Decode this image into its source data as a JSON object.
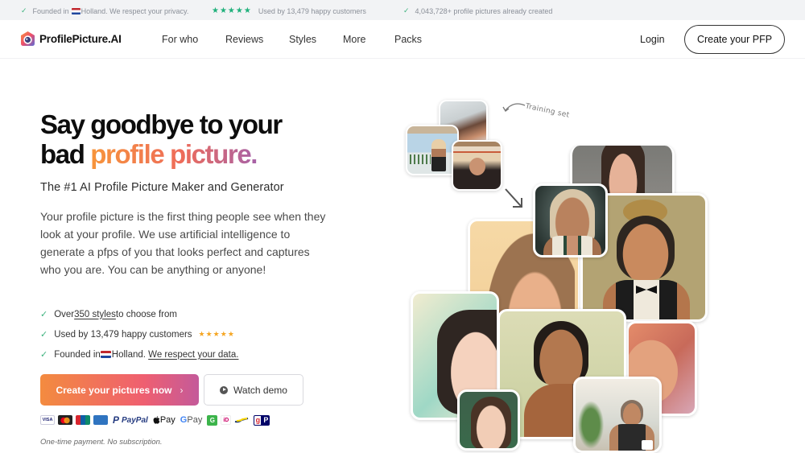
{
  "topbar": {
    "items": [
      {
        "icon": "check-icon",
        "text_prefix": "Founded in ",
        "flag": "netherlands-flag",
        "text_suffix": "Holland. We respect your privacy."
      },
      {
        "icon": "stars-icon",
        "stars": "★★★★★",
        "text": "Used by 13,479 happy customers"
      },
      {
        "icon": "check-icon",
        "text": "4,043,728+ profile pictures already created"
      }
    ],
    "check_glyph": "✓"
  },
  "nav": {
    "brand": "ProfilePicture.AI",
    "links": [
      "For who",
      "Reviews",
      "Styles",
      "More",
      "Packs"
    ],
    "login": "Login",
    "cta": "Create your PFP"
  },
  "hero": {
    "headline_line1": "Say goodbye to your",
    "headline_line2_plain": "bad ",
    "headline_line2_gradient": "profile picture.",
    "subtitle": "The #1 AI Profile Picture Maker and Generator",
    "description": "Your profile picture is the first thing people see when they look at your profile. We use artificial intelligence to generate a pfps of you that looks perfect and captures who you are. You can be anything or anyone!",
    "features": [
      {
        "pre": "Over ",
        "link": "350 styles ",
        "post": "to choose from"
      },
      {
        "pre": "Used by 13,479 happy customers",
        "stars": "★★★★★"
      },
      {
        "pre": "Founded in ",
        "flag": "netherlands-flag",
        "mid": "Holland. ",
        "link": "We respect your data."
      }
    ],
    "primary_button": "Create your pictures now",
    "primary_chevron": "›",
    "demo_button": "Watch demo",
    "payment_methods": [
      "VISA",
      "Mastercard",
      "UnionPay",
      "Amex",
      "PayPal",
      "Apple Pay",
      "Google Pay",
      "G",
      "iDEAL",
      "Bancontact",
      "giropay"
    ],
    "payment_labels": {
      "visa": "VISA",
      "paypal": "PayPal",
      "applepay": " Pay",
      "gpay_g": "G",
      "gpay": " Pay",
      "gtile": "G",
      "ideal": "iD",
      "giropay_g": "g",
      "giropay_p": "P"
    },
    "note": "One-time payment. No subscription."
  },
  "collage": {
    "training_label": "Training set",
    "colors": {
      "accent_gradient_start": "#f7953b",
      "accent_gradient_end": "#a762a8"
    }
  }
}
